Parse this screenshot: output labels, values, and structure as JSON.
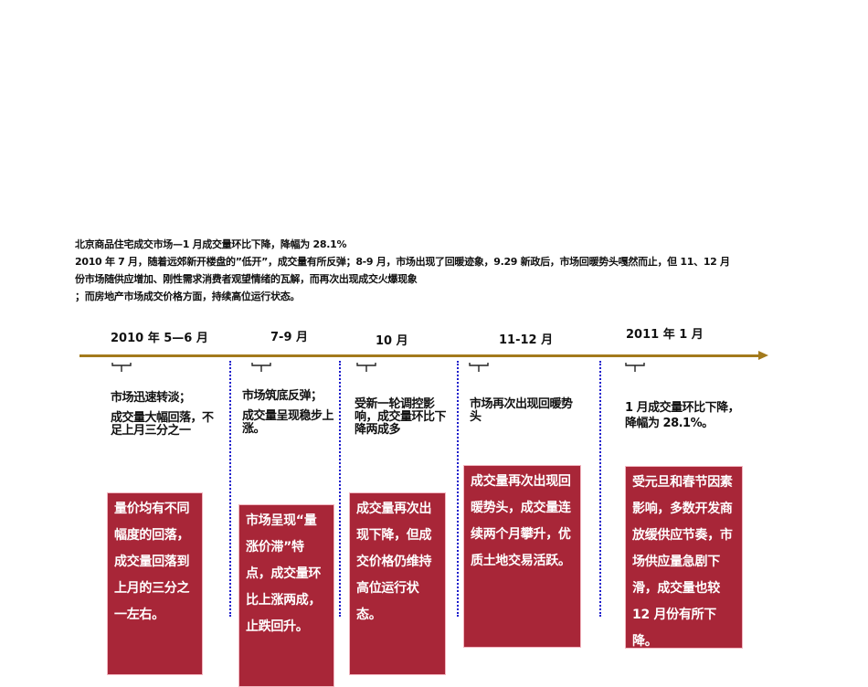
{
  "header": {
    "title": "北京商品住宅成交市场—1 月成交量环比下降，降幅为 28.1%",
    "line1": "2010 年 7 月，随着远郊新开楼盘的”低开”，成交量有所反弹；8-9 月，市场出现了回暖迹象，9.29 新政后，市场回暖势头嘎然而止，但 11、12 月",
    "line2": "份市场随供应增加、刚性需求消费者观望情绪的瓦解，而再次出现成交火爆现象",
    "line3": "；而房地产市场成交价格方面，持续高位运行状态。"
  },
  "timeline": {
    "accent_color": "#A37A1C",
    "box_color": "#A82638",
    "periods": [
      {
        "label": "2010 年 5—6 月",
        "desc": [
          "市场迅速转淡；",
          "成交量大幅回落，不足上月三分之一"
        ],
        "box": "量价均有不同幅度的回落，成交量回落到上月的三分之一左右。"
      },
      {
        "label": "7-9 月",
        "desc": [
          "市场筑底反弹；",
          "成交量呈现稳步上涨。"
        ],
        "box": "市场呈现“量涨价滞”特点，成交量环比上涨两成，止跌回升。"
      },
      {
        "label": "10 月",
        "desc": [
          "受新一轮调控影响，成交量环比下降两成多"
        ],
        "box": "成交量再次出现下降，但成交价格仍维持高位运行状态。"
      },
      {
        "label": "11-12 月",
        "desc": [
          "市场再次出现回暖势头"
        ],
        "box": "成交量再次出现回暖势头，成交量连续两个月攀升，优质土地交易活跃。"
      },
      {
        "label": "2011 年 1 月",
        "desc": [
          "1 月成交量环比下降，降幅为 28.1%。"
        ],
        "box": "受元旦和春节因素影响，多数开发商放缓供应节奏，市场供应量急剧下滑，成交量也较 12 月份有所下降。"
      }
    ]
  }
}
